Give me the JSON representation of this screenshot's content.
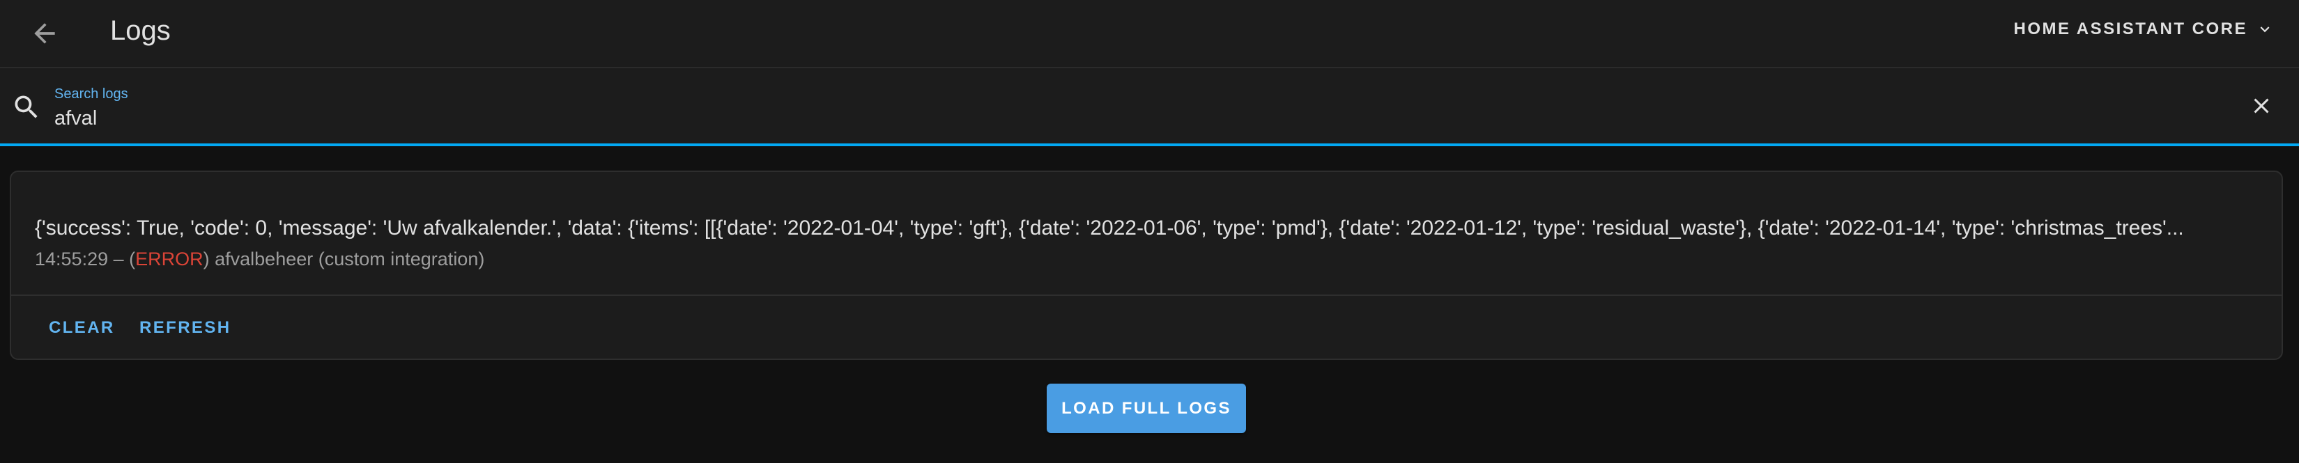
{
  "header": {
    "title": "Logs",
    "provider_label": "HOME ASSISTANT CORE",
    "back_icon": "arrow-left-icon",
    "dropdown_icon": "chevron-down-icon"
  },
  "search": {
    "label": "Search logs",
    "value": "afval",
    "icon": "search-icon",
    "clear_icon": "close-icon"
  },
  "log_entries": [
    {
      "message": "{'success': True, 'code': 0, 'message': 'Uw afvalkalender.', 'data': {'items': [[{'date': '2022-01-04', 'type': 'gft'}, {'date': '2022-01-06', 'type': 'pmd'}, {'date': '2022-01-12', 'type': 'residual_waste'}, {'date': '2022-01-14', 'type': 'christmas_trees'...",
      "time": "14:55:29",
      "separator": " – (",
      "level": "ERROR",
      "source": ") afvalbeheer (custom integration)"
    }
  ],
  "card_actions": {
    "clear_label": "CLEAR",
    "refresh_label": "REFRESH"
  },
  "load_full_label": "LOAD FULL LOGS",
  "colors": {
    "background": "#111111",
    "surface": "#1c1c1c",
    "accent": "#03a9f4",
    "primary_button": "#4a9de3",
    "error": "#db4437",
    "link": "#62b4f0"
  }
}
